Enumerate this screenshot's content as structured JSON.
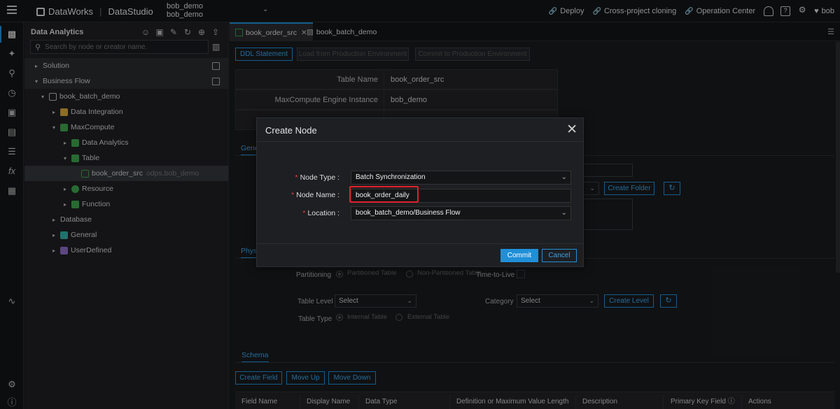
{
  "topbar": {
    "product": "DataWorks",
    "module": "DataStudio",
    "workspace_line1": "bob_demo",
    "workspace_line2": "bob_demo",
    "links": [
      "Deploy",
      "Cross-project cloning",
      "Operation Center"
    ],
    "help_icon_label": "?",
    "user": "bob"
  },
  "panel": {
    "title": "Data Analytics",
    "search_placeholder": "Search by node or creator name.",
    "tree": [
      {
        "label": "Solution"
      },
      {
        "label": "Business Flow"
      },
      {
        "label": "book_batch_demo"
      },
      {
        "label": "Data Integration"
      },
      {
        "label": "MaxCompute"
      },
      {
        "label": "Data Analytics"
      },
      {
        "label": "Table"
      },
      {
        "label": "book_order_src",
        "sub": "odps.bob_demo"
      },
      {
        "label": "Resource"
      },
      {
        "label": "Function"
      },
      {
        "label": "Database"
      },
      {
        "label": "General"
      },
      {
        "label": "UserDefined"
      }
    ]
  },
  "tabs": [
    {
      "label": "book_order_src"
    },
    {
      "label": "book_batch_demo"
    }
  ],
  "content": {
    "toolbar": {
      "ddl": "DDL Statement",
      "load": "Load from Production Environment",
      "commit_prod": "Commit to Production Environment"
    },
    "table_name_label": "Table Name",
    "table_name_value": "book_order_src",
    "engine_label": "MaxCompute Engine Instance",
    "engine_value": "bob_demo",
    "general_tab": "Gene",
    "create_folder": "Create Folder",
    "physical_tab": "Phys",
    "partitioning_label": "Partitioning",
    "partitioned_table": "Partitioned Table",
    "non_partitioned": "Non-Partitioned Table",
    "ttl_label": "Time-to-Live",
    "table_level_label": "Table Level",
    "table_level_value": "Select",
    "category_label": "Category",
    "category_value": "Select",
    "create_level": "Create Level",
    "table_type_label": "Table Type",
    "internal_table": "Internal Table",
    "external_table": "External Table",
    "schema_tab": "Schema",
    "create_field": "Create Field",
    "move_up": "Move Up",
    "move_down": "Move Down",
    "columns": [
      "Field Name",
      "Display Name",
      "Data Type",
      "Definition or Maximum Value Length",
      "Description",
      "Primary Key Field",
      "Actions"
    ]
  },
  "modal": {
    "title": "Create Node",
    "node_type_label": "Node Type :",
    "node_type_value": "Batch Synchronization",
    "node_name_label": "Node Name :",
    "node_name_value": "book_order_daily",
    "location_label": "Location :",
    "location_value": "book_batch_demo/Business Flow",
    "commit": "Commit",
    "cancel": "Cancel"
  },
  "colors": {
    "accent": "#1f8fd8",
    "highlight": "#e0202a"
  }
}
